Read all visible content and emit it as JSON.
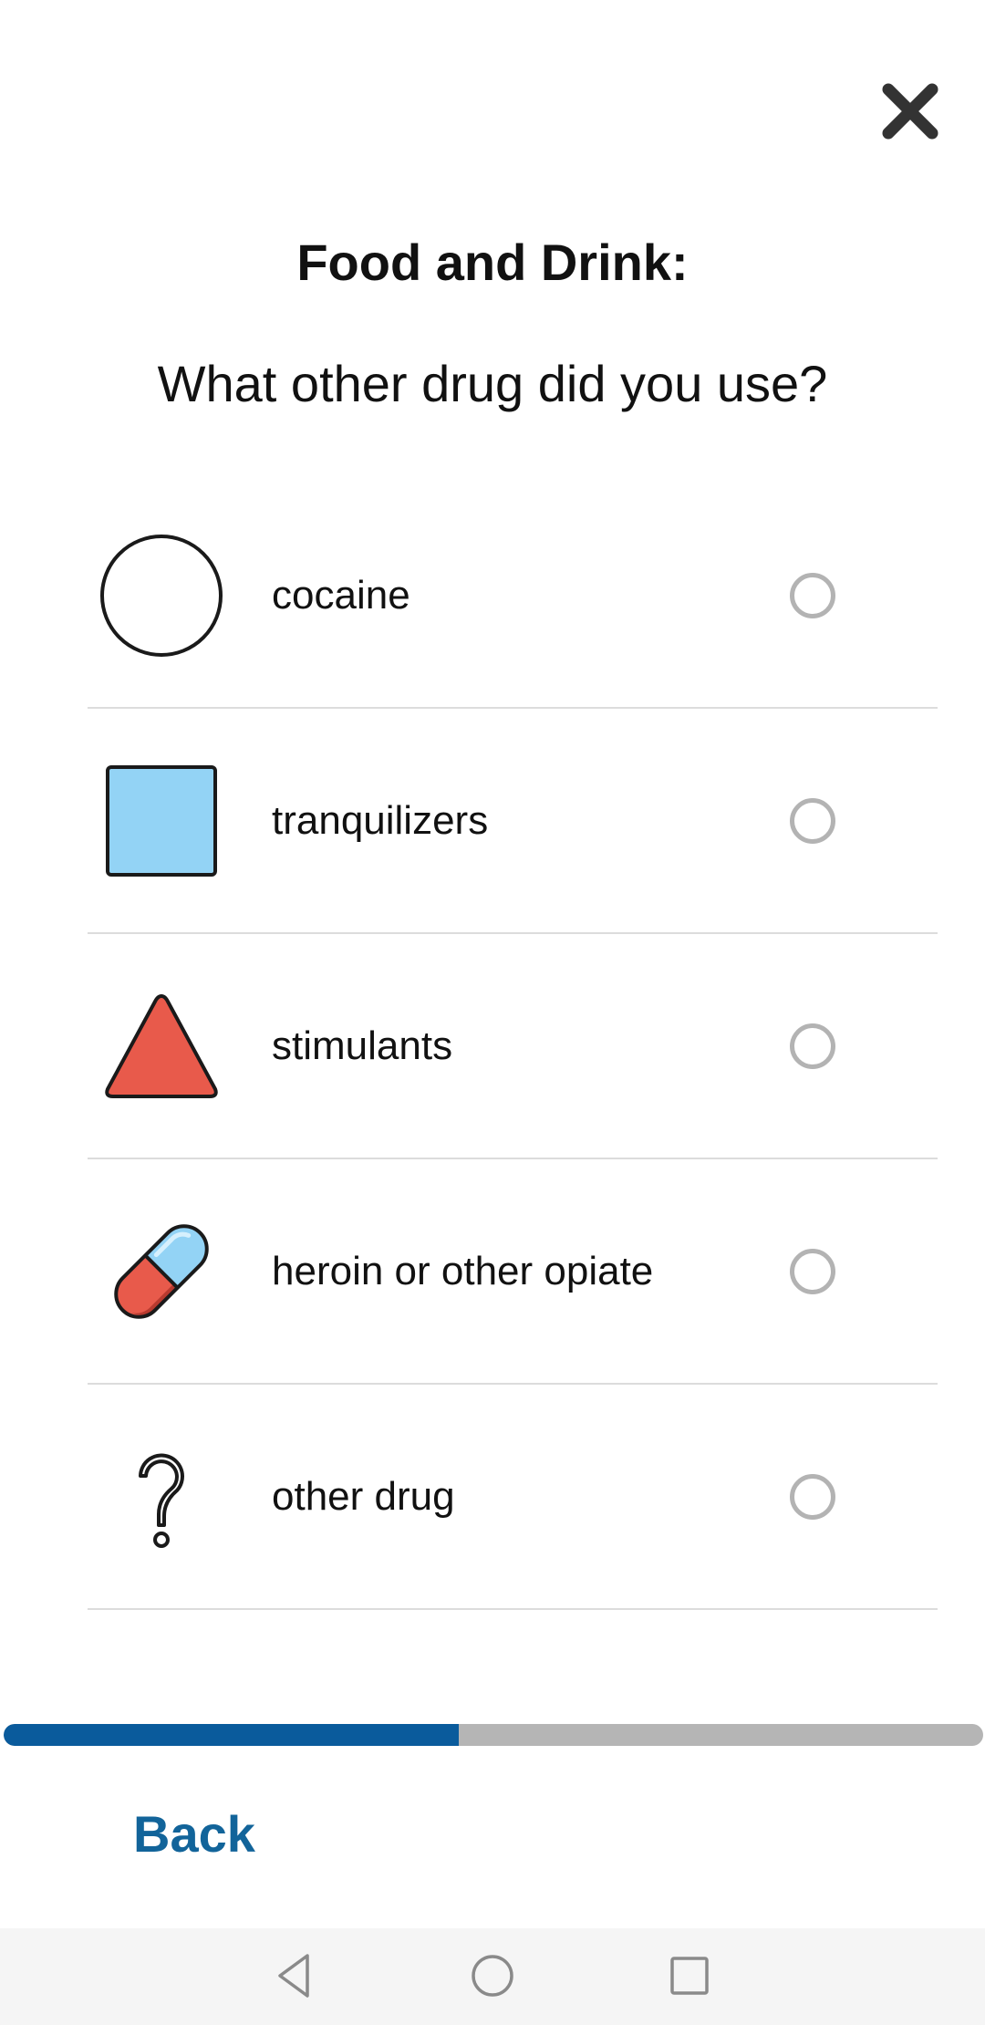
{
  "header": {
    "close_icon": "close-icon",
    "section_title": "Food and Drink:",
    "question": "What other drug did you use?"
  },
  "options": [
    {
      "label": "cocaine",
      "icon": "circle-icon",
      "selected": false
    },
    {
      "label": "tranquilizers",
      "icon": "square-icon",
      "selected": false
    },
    {
      "label": "stimulants",
      "icon": "triangle-icon",
      "selected": false
    },
    {
      "label": "heroin or other opiate",
      "icon": "pill-icon",
      "selected": false
    },
    {
      "label": "other drug",
      "icon": "question-mark-icon",
      "selected": false
    }
  ],
  "progress": {
    "fraction": 0.465,
    "fill_color": "#0a5b9c",
    "track_color": "#b5b5b5"
  },
  "footer": {
    "back_label": "Back",
    "back_color": "#12649a"
  },
  "system_nav": {
    "back_icon": "nav-back-icon",
    "home_icon": "nav-home-icon",
    "recents_icon": "nav-recents-icon"
  }
}
